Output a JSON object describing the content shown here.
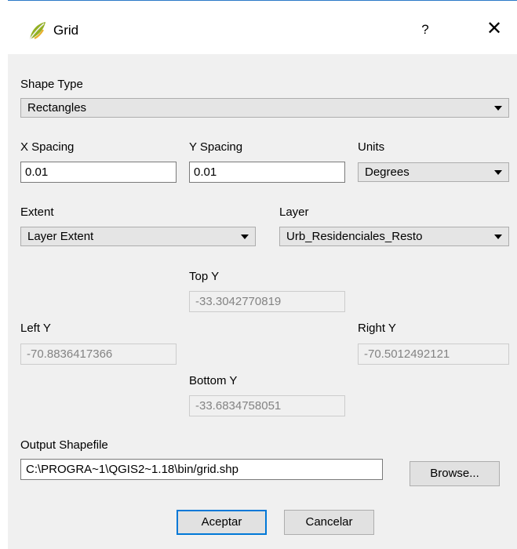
{
  "dialog": {
    "title": "Grid",
    "help_label": "?",
    "close_label": "✕"
  },
  "shape_type": {
    "label": "Shape Type",
    "value": "Rectangles"
  },
  "x_spacing": {
    "label": "X Spacing",
    "value": "0.01"
  },
  "y_spacing": {
    "label": "Y Spacing",
    "value": "0.01"
  },
  "units": {
    "label": "Units",
    "value": "Degrees"
  },
  "extent": {
    "label": "Extent",
    "value": "Layer Extent"
  },
  "layer": {
    "label": "Layer",
    "value": "Urb_Residenciales_Resto"
  },
  "top_y": {
    "label": "Top Y",
    "value": "-33.3042770819"
  },
  "left_y": {
    "label": "Left Y",
    "value": "-70.8836417366"
  },
  "right_y": {
    "label": "Right Y",
    "value": "-70.5012492121"
  },
  "bottom_y": {
    "label": "Bottom Y",
    "value": "-33.6834758051"
  },
  "output": {
    "label": "Output Shapefile",
    "value": "C:\\PROGRA~1\\QGIS2~1.18\\bin/grid.shp",
    "browse_label": "Browse..."
  },
  "buttons": {
    "ok_label": "Aceptar",
    "cancel_label": "Cancelar"
  },
  "icons": {
    "app": "qgis-leaf-icon",
    "arrow": "chevron-down-icon"
  },
  "colors": {
    "accent": "#0078d7",
    "title_line": "#2b79c8",
    "disabled_text": "#838383"
  }
}
